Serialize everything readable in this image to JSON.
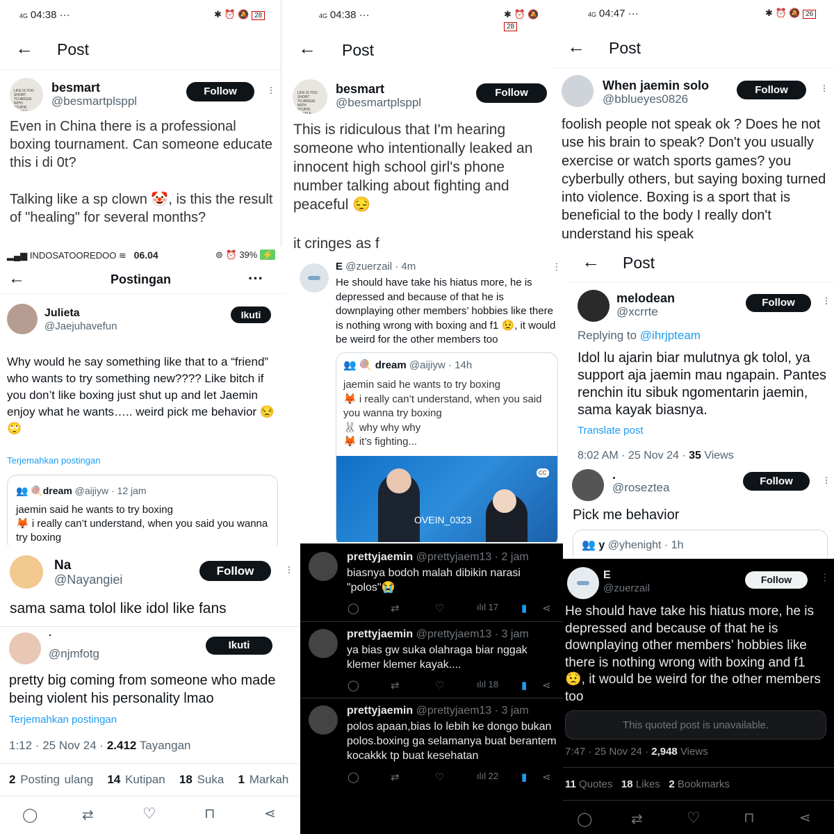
{
  "status": {
    "p1": {
      "time": "04:38 ···",
      "net": "4G",
      "batt": "28"
    },
    "p2": {
      "time": "04:38 ···",
      "net": "4G",
      "batt": "28"
    },
    "p3": {
      "time": "04:47 ···",
      "net": "4G",
      "batt": "26"
    },
    "p4": {
      "carrier": "INDOSATOOREDOO",
      "time": "06.04",
      "batt": "39%"
    }
  },
  "header": {
    "post": "Post",
    "postingan": "Postingan",
    "more": "···"
  },
  "p1": {
    "name": "besmart",
    "handle": "@besmartplsppl",
    "follow": "Follow",
    "line1": "Even in China there is a professional boxing tournament. Can someone educate this i di 0t?",
    "line2": "Talking like a sp clown 🤡, is this the result of \"healing\" for several months?"
  },
  "p2": {
    "name": "besmart",
    "handle": "@besmartplsppl",
    "follow": "Follow",
    "line1": "This is ridiculous that I'm hearing someone who intentionally leaked an innocent high school girl's phone number talking about fighting and peaceful 😔",
    "line2": "it cringes as f"
  },
  "p3": {
    "name": "When jaemin solo",
    "handle": "@bblueyes0826",
    "follow": "Follow",
    "text": "foolish people not speak ok ? Does he not use his brain to speak? Don't you usually exercise or watch sports games? you cyberbully others, but saying boxing turned into violence. Boxing is a sport that is beneficial to the body I really don't understand his speak"
  },
  "p4": {
    "name": "Julieta",
    "handle": "@Jaejuhavefun",
    "follow": "Ikuti",
    "text": "Why would he say something like that to a “friend” who wants to try something new???? Like bitch if you don’t like boxing just shut up and let Jaemin enjoy what he wants….. weird pick me behavior 😒🙄",
    "translate": "Terjemahkan postingan",
    "q_name": "🍭dream",
    "q_handle": "@aijiyw · 12 jam",
    "q_line1": "jaemin said he wants to try boxing",
    "q_line2": "🦊 i really can’t understand, when you said you wanna try boxing"
  },
  "p5": {
    "name": "E",
    "handle": "@zuerzail · 4m",
    "text": "He should have take his hiatus more, he is depressed and because of that he is downplaying other members’ hobbies like there is nothing wrong with boxing and f1 😟, it would be weird for the other members too",
    "q_name": "🍭 dream",
    "q_handle": "@aijiyw · 14h",
    "q_l1": "jaemin said he wants to try boxing",
    "q_l2": "🦊 i really can’t understand, when you said you wanna try boxing",
    "q_l3": "🐰 why why why",
    "q_l4": "🦊 it’s fighting...",
    "img_tag": "OVEIN_0323",
    "img_cc": "CC"
  },
  "p6": {
    "name": "melodean",
    "handle": "@xcrrte",
    "follow": "Follow",
    "replying_prefix": "Replying to ",
    "replying_to": "@ihrjpteam",
    "text": "Idol lu ajarin biar mulutnya gk tolol, ya support aja jaemin mau ngapain. Pantes renchin itu sibuk ngomentarin jaemin, sama kayak biasnya.",
    "translate": "Translate post",
    "meta": "8:02 AM · 25 Nov 24 · ",
    "views_n": "35",
    "views_l": " Views",
    "r_name": ".",
    "r_handle": "@roseztea",
    "r_follow": "Follow",
    "r_text": "Pick me behavior",
    "r_q_name": "y",
    "r_q_handle": "@yhenight · 1h"
  },
  "p7": {
    "name": "Na",
    "handle": "@Nayangiei",
    "follow": "Follow",
    "text": "sama sama tolol like idol like fans",
    "r_name": ".",
    "r_handle": "@njmfotg",
    "r_follow": "Ikuti",
    "r_text": "pretty big coming from someone who made being violent his personality lmao",
    "translate": "Terjemahkan postingan",
    "meta": "1:12 · 25 Nov 24 · ",
    "views_n": "2.412",
    "views_l": " Tayangan",
    "s1n": "2",
    "s1l": "Posting ulang",
    "s2n": "14",
    "s2l": "Kutipan",
    "s3n": "18",
    "s3l": "Suka",
    "s4n": "1",
    "s4l": "Markah"
  },
  "p8": {
    "items": [
      {
        "name": "prettyjaemin",
        "handle": "@prettyjaem13 · 2 jam",
        "text": "biasnya bodoh malah dibikin narasi \"polos\"😭",
        "views": "17"
      },
      {
        "name": "prettyjaemin",
        "handle": "@prettyjaem13 · 3 jam",
        "text": "ya bias gw suka olahraga biar nggak klemer klemer kayak....",
        "views": "18"
      },
      {
        "name": "prettyjaemin",
        "handle": "@prettyjaem13 · 3 jam",
        "text": "polos apaan,bias lo lebih ke dongo bukan polos.boxing ga selamanya buat berantem kocakkk tp buat kesehatan",
        "views": "22"
      }
    ]
  },
  "p9": {
    "name": "E",
    "handle": "@zuerzail",
    "follow": "Follow",
    "text": "He should have take his hiatus more, he is depressed and because of that he is downplaying other members’ hobbies like there is nothing wrong with boxing and f1 😟, it would be weird for the other members too",
    "unavailable": "This quoted post is unavailable.",
    "meta": "7:47 · 25 Nov 24 · ",
    "views_n": "2,948",
    "views_l": " Views",
    "s1n": "11",
    "s1l": "Quotes",
    "s2n": "18",
    "s2l": "Likes",
    "s3n": "2",
    "s3l": "Bookmarks"
  },
  "colors": {
    "accent": "#1d9bf0",
    "bookmark_active": "#1d9bf0",
    "dark_bg": "#000000"
  }
}
